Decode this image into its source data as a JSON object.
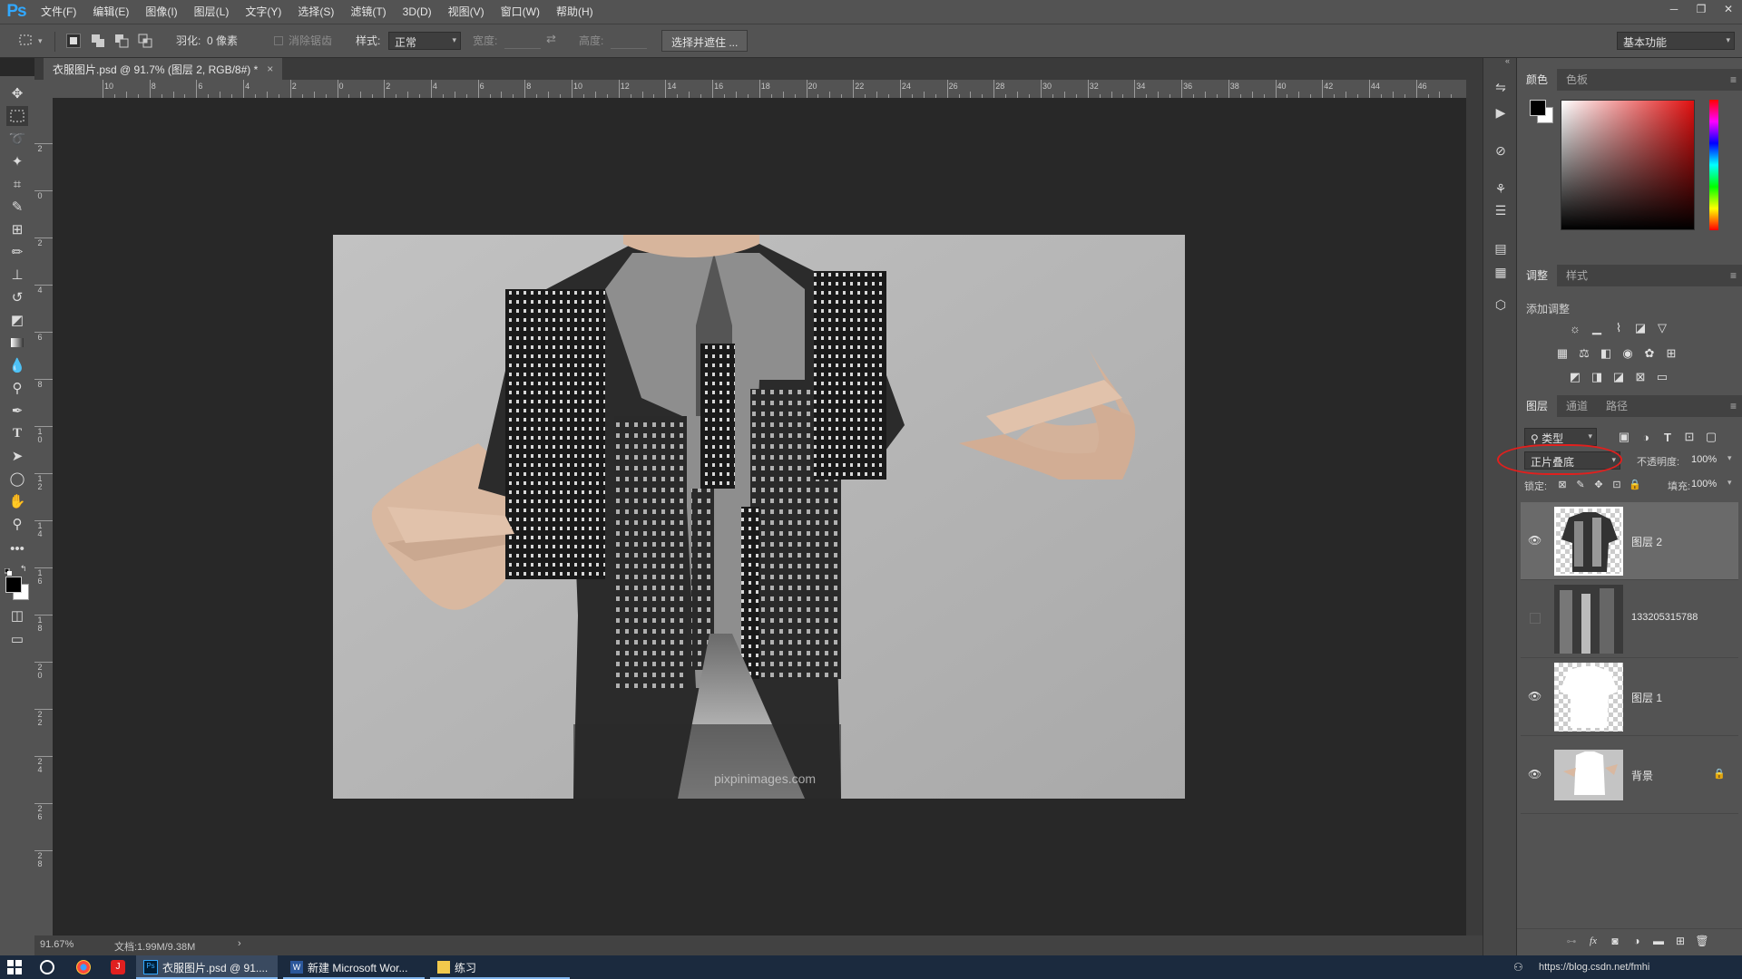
{
  "app": {
    "logo": "Ps",
    "menu": [
      "文件(F)",
      "编辑(E)",
      "图像(I)",
      "图层(L)",
      "文字(Y)",
      "选择(S)",
      "滤镜(T)",
      "3D(D)",
      "视图(V)",
      "窗口(W)",
      "帮助(H)"
    ],
    "window_controls": [
      "minimize-icon",
      "restore-icon",
      "close-icon"
    ]
  },
  "options": {
    "feather_label": "羽化:",
    "feather_value": "0 像素",
    "antialias_label": "消除锯齿",
    "style_label": "样式:",
    "style_value": "正常",
    "width_label": "宽度:",
    "height_label": "高度:",
    "select_mask_button": "选择并遮住 ...",
    "workspace": "基本功能"
  },
  "document": {
    "tab_title": "衣服图片.psd @ 91.7% (图层 2, RGB/8#) *",
    "tab_close": "×",
    "ruler_h_labels": [
      "10",
      "8",
      "6",
      "4",
      "2",
      "0",
      "2",
      "4",
      "6",
      "8",
      "10",
      "12",
      "14",
      "16",
      "18",
      "20",
      "22",
      "24",
      "26",
      "28",
      "30",
      "32",
      "34",
      "36",
      "38",
      "40",
      "42",
      "44",
      "46"
    ],
    "ruler_v_labels": [
      "2",
      "0",
      "2",
      "4",
      "6",
      "8",
      "10",
      "12",
      "14",
      "16",
      "18",
      "20",
      "22",
      "24",
      "26",
      "28"
    ],
    "canvas_watermark": "pixpinimages.com"
  },
  "status": {
    "zoom": "91.67%",
    "doc_info": "文档:1.99M/9.38M",
    "arrow": "›"
  },
  "panels": {
    "color_tabs": [
      "颜色",
      "色板"
    ],
    "adjust_tabs": [
      "调整",
      "样式"
    ],
    "add_adjustment": "添加调整",
    "layers_tabs": [
      "图层",
      "通道",
      "路径"
    ],
    "filter_kind": "类型",
    "blend_mode": "正片叠底",
    "opacity_label": "不透明度:",
    "opacity_value": "100%",
    "lock_label": "锁定:",
    "fill_label": "填充:",
    "fill_value": "100%"
  },
  "layers": [
    {
      "name": "图层 2",
      "visible": true,
      "selected": true
    },
    {
      "name": "133205315788",
      "visible": false,
      "selected": false
    },
    {
      "name": "图层 1",
      "visible": true,
      "selected": false
    },
    {
      "name": "背景",
      "visible": true,
      "selected": false,
      "locked": true
    }
  ],
  "taskbar": {
    "items": [
      "衣服图片.psd @ 91....",
      "新建 Microsoft Wor...",
      "练习"
    ],
    "tray_text": "https://blog.csdn.net/fmhi"
  },
  "colors": {
    "accent": "#31a8ff",
    "highlight_annotation": "#e0201e"
  }
}
